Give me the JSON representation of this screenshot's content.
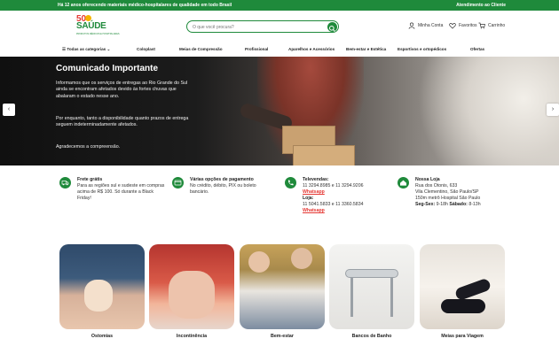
{
  "topbar": {
    "message": "Há 12 anos oferecendo materiais médico-hospitalares de qualidade em todo Brasil",
    "service": "Atendimento ao Cliente"
  },
  "logo": {
    "number": "50",
    "name": "SAÚDE",
    "tagline": "PRODUTOS MÉDICOS E HOSPITALARES"
  },
  "search": {
    "placeholder": "O que você procura?"
  },
  "account": {
    "my_account": "Minha Conta",
    "favorites": "Favoritos",
    "cart": "Carrinho"
  },
  "catnav": [
    "☰ Todas as categorias ⌄",
    "Coloplast",
    "Meias de Compressão",
    "Profissional",
    "Aparelhos e Acessórios",
    "Bem-estar e Estética",
    "Esportivos e ortopédicos",
    "Ofertas"
  ],
  "hero": {
    "title": "Comunicado Importante",
    "p1": "Informamos que os serviços de entregas ao Rio Grande do Sul ainda se encontram afetados devido às fortes chuvas que abalaram o estado nesse ano.",
    "p2": "Por enquanto, tanto a disponibilidade quanto prazos de entrega seguem indeterminadamente afetados.",
    "p3": "Agradecemos a compreensão.",
    "prev": "‹",
    "next": "›"
  },
  "info": {
    "frete": {
      "title": "Frete grátis",
      "text": "Para as regiões sul e sudeste em compras acima de R$ 100. Só durante a Black Friday!"
    },
    "pagamento": {
      "title": "Várias opções de pagamento",
      "text": "No crédito, débito, PIX ou boleto bancário."
    },
    "telefones": {
      "title": "Televendas:",
      "phones1": "11 3294.8985 e 11 3294.9206",
      "wa1": "Whatsapp",
      "loja_label": "Loja:",
      "phones2": "11 5041.5833 e 11 3360.5834",
      "wa2": "Whatsapp"
    },
    "loja": {
      "title": "Nossa Loja",
      "line1": "Rua dos Otonis, 633",
      "line2": "Vila Clementino, São Paulo/SP",
      "line3": "150m metrô Hospital São Paulo",
      "hours_label1": "Seg-Sex:",
      "hours1": "9-18h",
      "hours_label2": "Sábado:",
      "hours2": "8-13h"
    }
  },
  "categories": [
    "Ostomias",
    "Incontinência",
    "Bem-estar",
    "Bancos de Banho",
    "Meias para Viagem"
  ],
  "colors": {
    "brand_green": "#1f8a3b",
    "accent_red": "#e53935"
  }
}
